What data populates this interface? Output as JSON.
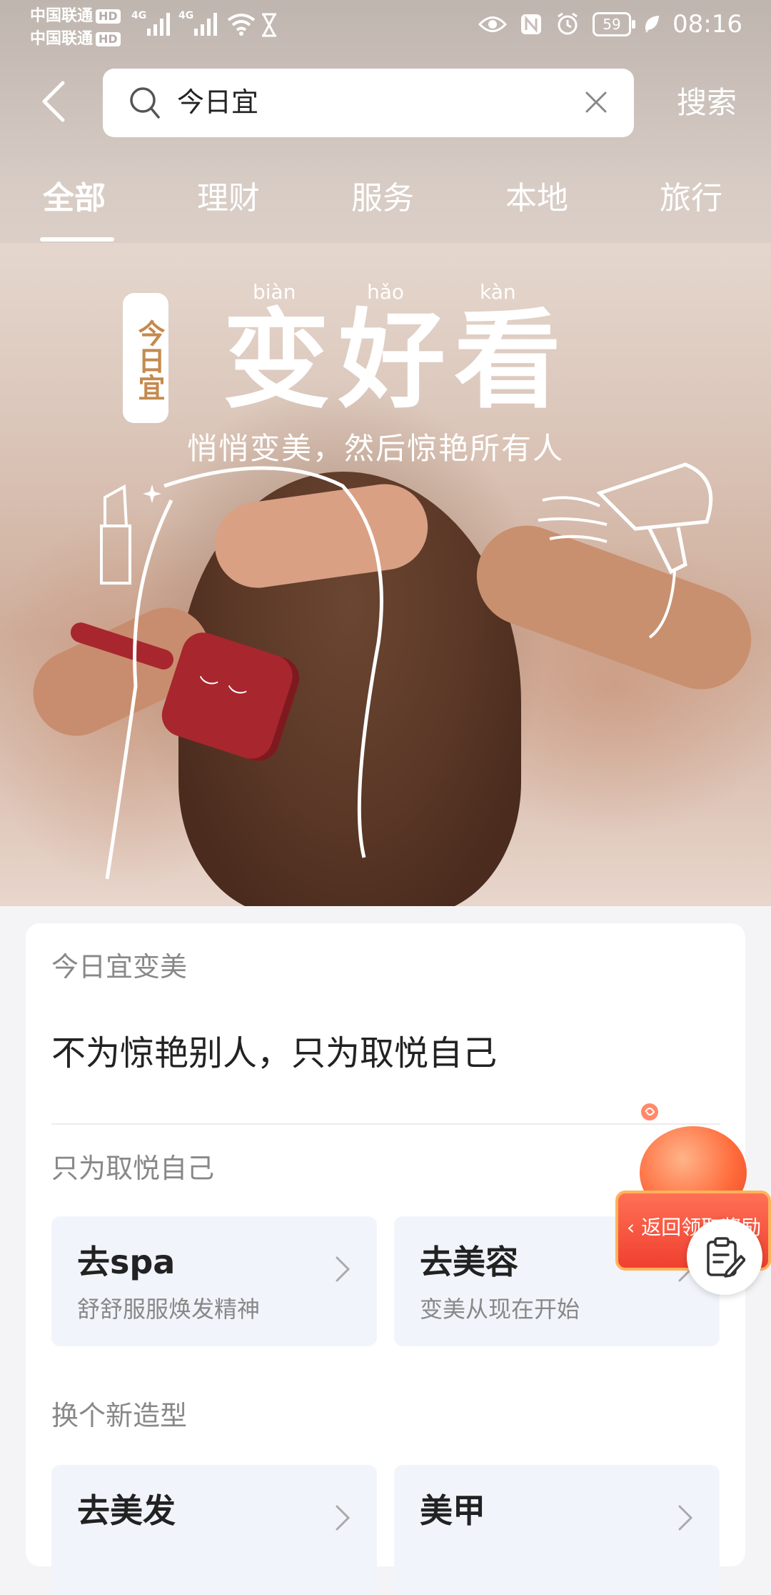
{
  "status_bar": {
    "carrier_1": "中国联通",
    "carrier_2": "中国联通",
    "hd_badge": "HD",
    "network_1": "4G",
    "network_2": "4G",
    "battery": "59",
    "time": "08:16"
  },
  "search": {
    "query": "今日宜",
    "submit_label": "搜索"
  },
  "tabs": [
    {
      "label": "全部",
      "active": true
    },
    {
      "label": "理财",
      "active": false
    },
    {
      "label": "服务",
      "active": false
    },
    {
      "label": "本地",
      "active": false
    },
    {
      "label": "旅行",
      "active": false
    }
  ],
  "banner": {
    "badge": "今日宜",
    "pinyin": [
      "biàn",
      "hǎo",
      "kàn"
    ],
    "title": "变好看",
    "subtitle": "悄悄变美，然后惊艳所有人"
  },
  "card": {
    "eyebrow": "今日宜变美",
    "headline": "不为惊艳别人，只为取悦自己",
    "sections": [
      {
        "title": "只为取悦自己",
        "tiles": [
          {
            "title": "去spa",
            "subtitle": "舒舒服服焕发精神"
          },
          {
            "title": "去美容",
            "subtitle": "变美从现在开始"
          }
        ]
      },
      {
        "title": "换个新造型",
        "tiles": [
          {
            "title": "去美发",
            "subtitle": ""
          },
          {
            "title": "美甲",
            "subtitle": ""
          }
        ]
      }
    ]
  },
  "promo": {
    "label": "返回领取奖励"
  },
  "icons": {
    "back": "chevron-left-icon",
    "search": "search-icon",
    "clear": "close-icon",
    "tile_arrow": "chevron-right-icon",
    "edit": "clipboard-edit-icon"
  }
}
